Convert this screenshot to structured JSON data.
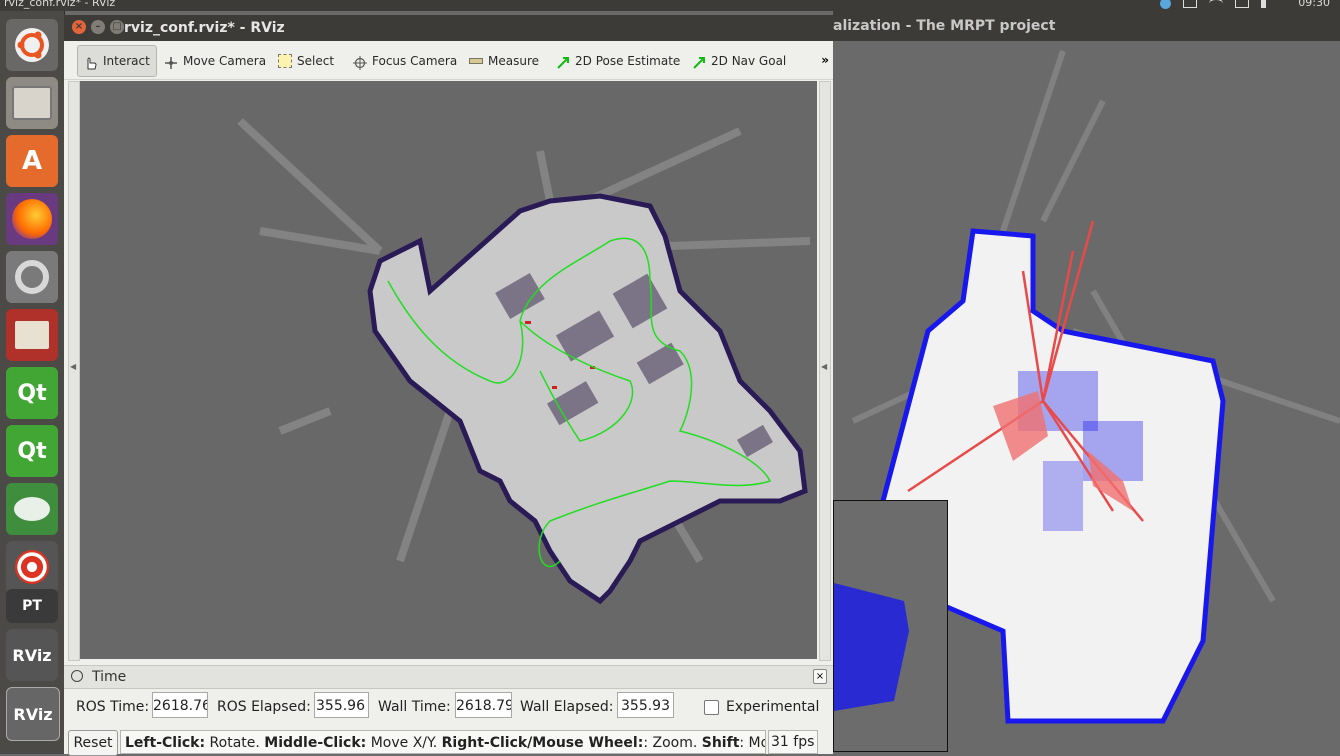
{
  "system": {
    "active_window_title": "rviz_conf.rviz* - RViz",
    "clock": "09:30"
  },
  "launcher": {
    "items": [
      {
        "name": "ubuntu-dash-icon"
      },
      {
        "name": "files-icon"
      },
      {
        "name": "software-center-icon",
        "glyph": "A"
      },
      {
        "name": "firefox-icon"
      },
      {
        "name": "settings-icon"
      },
      {
        "name": "text-editor-icon"
      },
      {
        "name": "qt-assistant-icon",
        "glyph": "Qt"
      },
      {
        "name": "qt-creator-icon",
        "glyph": "Qt"
      },
      {
        "name": "app-icon"
      },
      {
        "name": "app-red-icon"
      },
      {
        "name": "pt-icon",
        "glyph": "PT"
      },
      {
        "name": "rviz-icon-1",
        "glyph": "RViz"
      },
      {
        "name": "rviz-icon-2",
        "glyph": "RViz"
      }
    ]
  },
  "mrpt_window": {
    "title": "alization - The MRPT project"
  },
  "rviz": {
    "title": "rviz_conf.rviz* - RViz",
    "toolbar": {
      "interact": "Interact",
      "move_camera": "Move Camera",
      "select": "Select",
      "focus_camera": "Focus Camera",
      "measure": "Measure",
      "pose_estimate": "2D Pose Estimate",
      "nav_goal": "2D Nav Goal",
      "more": "»"
    },
    "time_panel": {
      "title": "Time",
      "ros_time_label": "ROS Time:",
      "ros_time": "2618.76",
      "ros_elapsed_label": "ROS Elapsed:",
      "ros_elapsed": "355.96",
      "wall_time_label": "Wall Time:",
      "wall_time": "2618.79",
      "wall_elapsed_label": "Wall Elapsed:",
      "wall_elapsed": "355.93",
      "experimental_label": "Experimental"
    },
    "status": {
      "reset": "Reset",
      "help_1": "Left-Click:",
      "help_2": " Rotate. ",
      "help_3": "Middle-Click:",
      "help_4": " Move X/Y. ",
      "help_5": "Right-Click/Mouse Wheel:",
      "help_6": ": Zoom. ",
      "help_7": "Shift",
      "help_8": ": More op",
      "fps": "31 fps"
    }
  },
  "colors": {
    "map_free": "#c9c9c9",
    "obstacle": "#2a1a55",
    "path": "#22dd22",
    "mrpt_points": "#1010ee",
    "laser": "#e85a5a"
  }
}
